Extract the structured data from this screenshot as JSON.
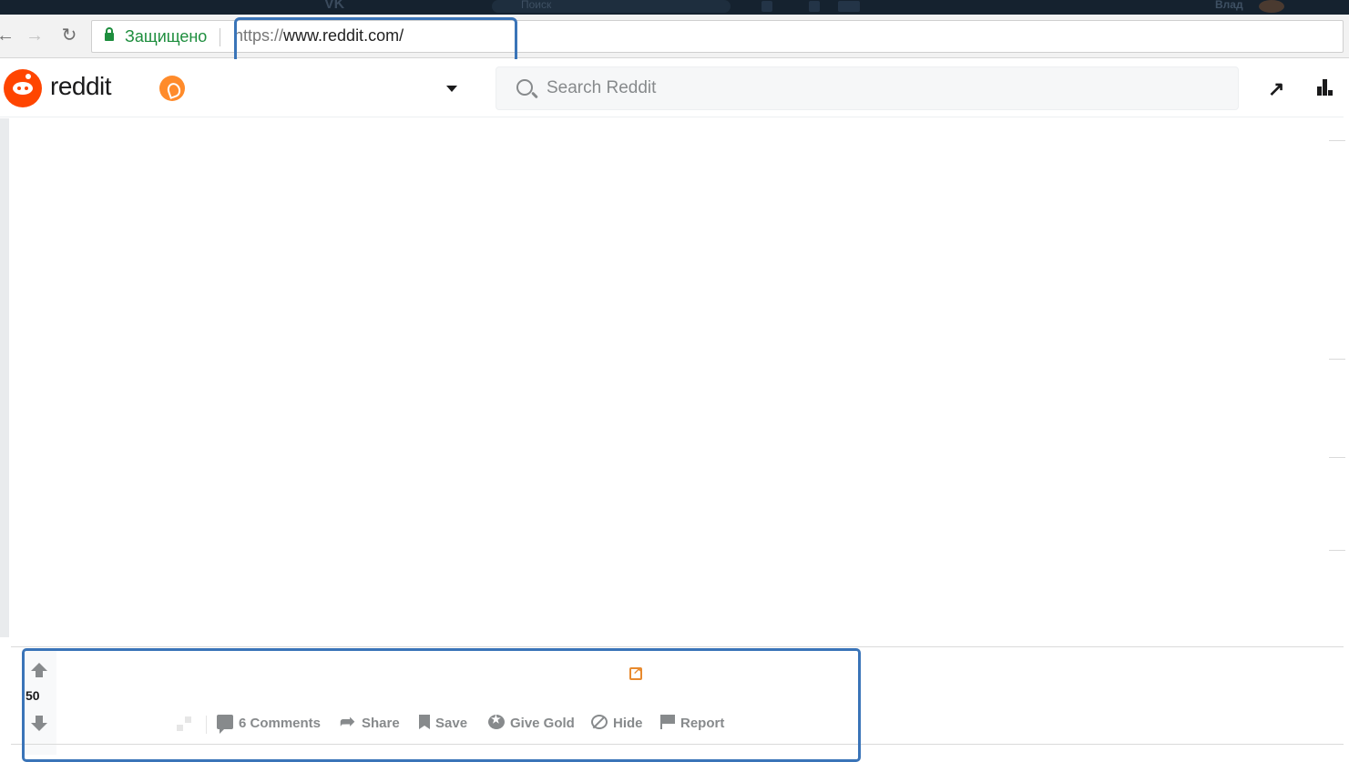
{
  "os_bar": {
    "search_placeholder": "Поиск",
    "user_name": "Влад"
  },
  "browser": {
    "security_label": "Защищено",
    "url_scheme": "https://",
    "url_host": "www.reddit.com/"
  },
  "header": {
    "logo_text": "reddit",
    "search_placeholder": "Search Reddit"
  },
  "post": {
    "score": "50",
    "actions": {
      "comments": "6 Comments",
      "share": "Share",
      "save": "Save",
      "give_gold": "Give Gold",
      "hide": "Hide",
      "report": "Report"
    }
  },
  "colors": {
    "reddit_orange": "#ff4500",
    "secure_green": "#1e8e3e",
    "highlight_blue": "#3a74b8",
    "action_gray": "#878a8c"
  }
}
